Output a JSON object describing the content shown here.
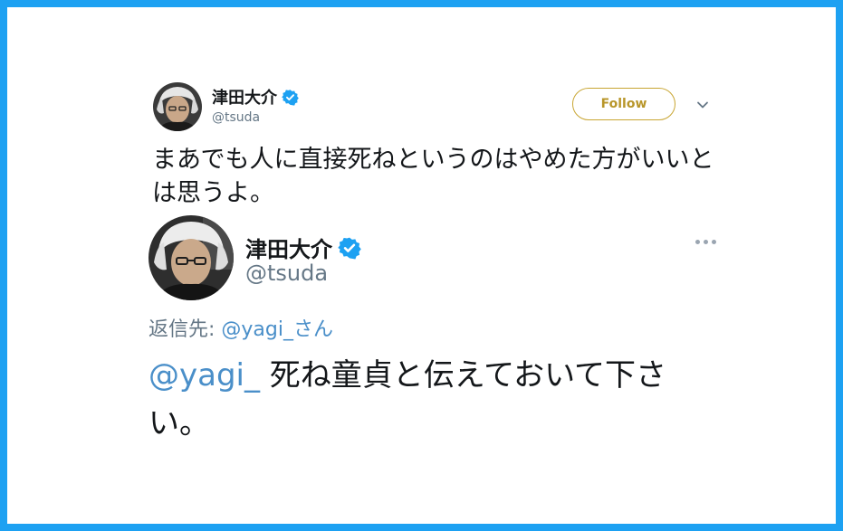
{
  "tweet": {
    "display_name": "津田大介",
    "handle": "@tsuda",
    "follow_label": "Follow",
    "text": "まあでも人に直接死ねというのはやめた方がいいとは思うよ。",
    "verified_icon": "verified-badge-icon",
    "menu_icon": "chevron-down-icon"
  },
  "quoted_tweet": {
    "display_name": "津田大介",
    "handle": "@tsuda",
    "reply_prefix": "返信先: ",
    "reply_to": "@yagi_さん",
    "mention": "@yagi_",
    "text": " 死ね童貞と伝えておいて下さい。",
    "verified_icon": "verified-badge-icon",
    "menu_icon": "more-dots-icon"
  },
  "colors": {
    "border": "#1da1f2",
    "verified": "#1da1f2",
    "follow": "#b8962a",
    "mention": "#4a8fc9"
  }
}
